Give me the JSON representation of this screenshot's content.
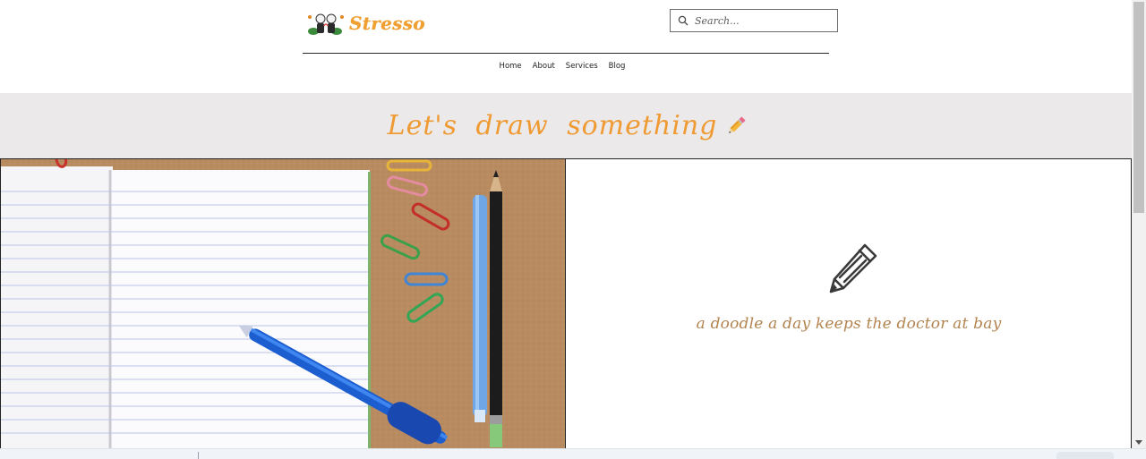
{
  "header": {
    "logo_text": "Stresso",
    "search": {
      "placeholder": "Search..."
    },
    "nav": [
      "Home",
      "About",
      "Services",
      "Blog"
    ]
  },
  "banner": {
    "title": "Let's draw something",
    "emoji_icon": "pencil-icon"
  },
  "feature": {
    "tagline": "a doodle a day keeps the doctor at bay",
    "icon": "pencil-icon",
    "image": "notebook-with-pens-and-paperclips"
  },
  "colors": {
    "accent_orange": "#ef9a32",
    "tagline_brown": "#b3834f",
    "banner_bg": "#ebe9ea",
    "cork_bg": "#b88a5f"
  }
}
